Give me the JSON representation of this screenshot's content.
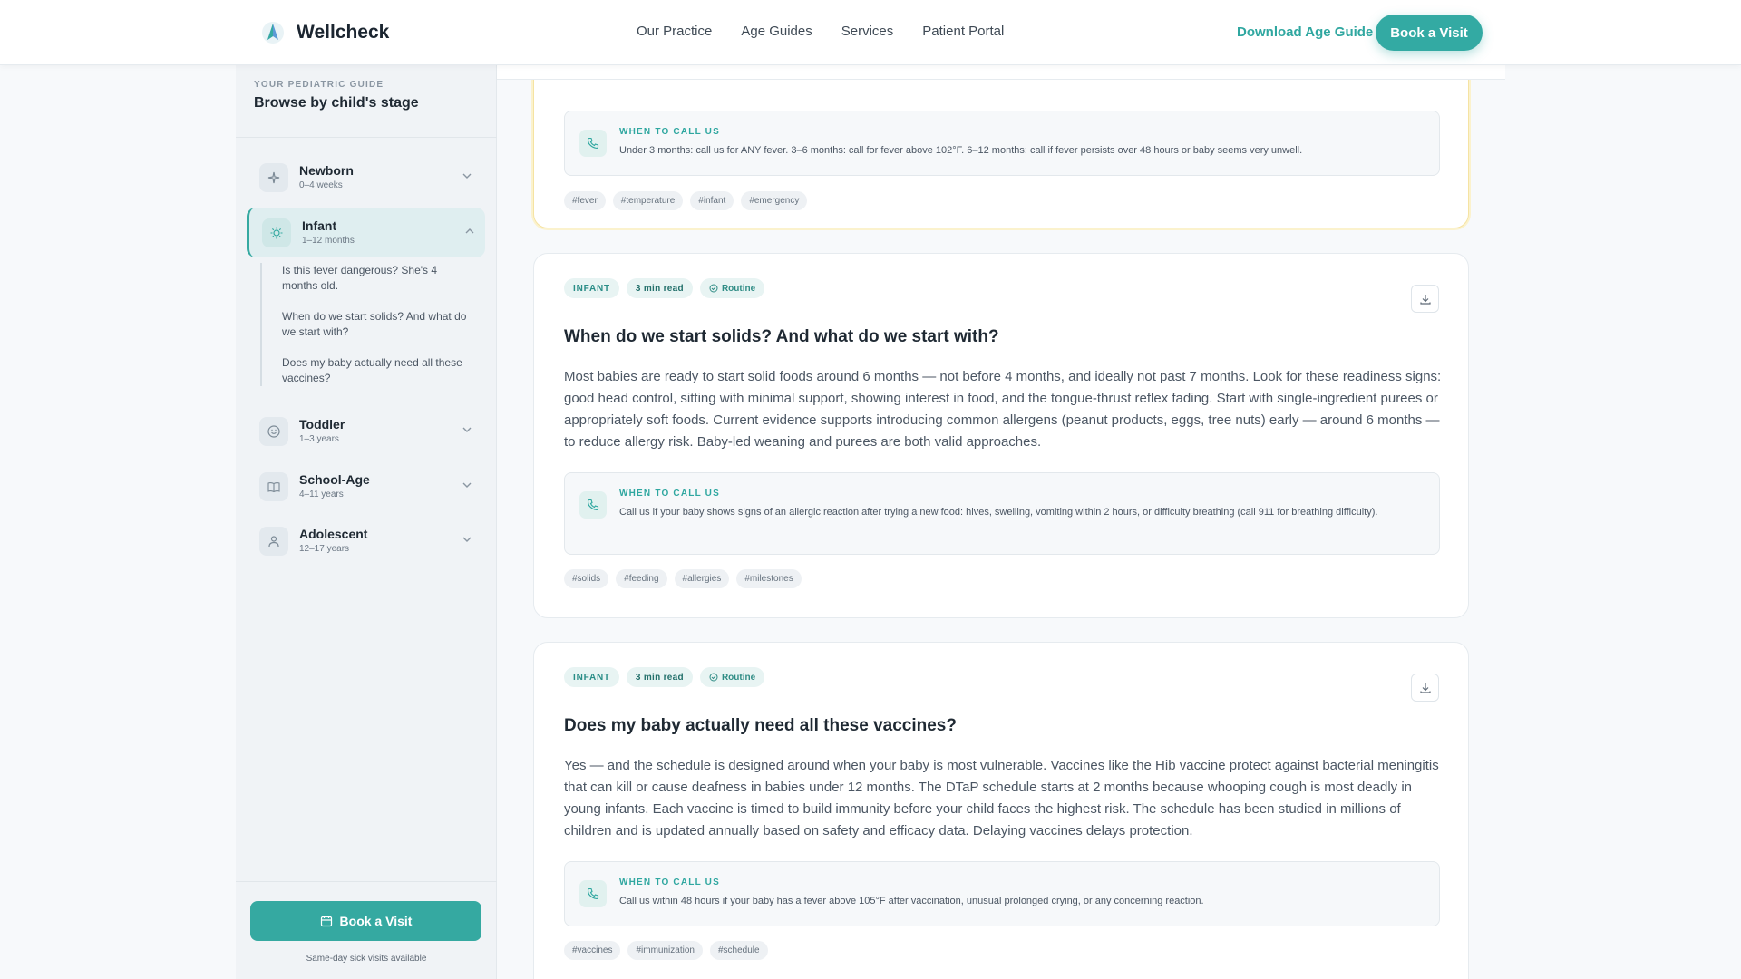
{
  "header": {
    "brand": "Wellcheck",
    "nav": [
      "Our Practice",
      "Age Guides",
      "Services",
      "Patient Portal"
    ],
    "download_label": "Download Age Guide",
    "book_label": "Book a Visit"
  },
  "sidebar": {
    "eyebrow": "YOUR PEDIATRIC GUIDE",
    "title": "Browse by child's stage",
    "stages": [
      {
        "name": "Newborn",
        "range": "0–4 weeks",
        "icon": "sparkle-icon"
      },
      {
        "name": "Infant",
        "range": "1–12 months",
        "icon": "sun-icon"
      },
      {
        "name": "Toddler",
        "range": "1–3 years",
        "icon": "smile-icon"
      },
      {
        "name": "School-Age",
        "range": "4–11 years",
        "icon": "book-icon"
      },
      {
        "name": "Adolescent",
        "range": "12–17 years",
        "icon": "person-icon"
      }
    ],
    "active_stage": "Infant",
    "infant_questions": [
      "Is this fever dangerous? She's 4 months old.",
      "When do we start solids? And what do we start with?",
      "Does my baby actually need all these vaccines?"
    ],
    "book_label": "Book a Visit",
    "note": "Same-day sick visits available"
  },
  "cards": [
    {
      "call_label": "WHEN TO CALL US",
      "call_text": "Under 3 months: call us for ANY fever. 3–6 months: call for fever above 102°F. 6–12 months: call if fever persists over 48 hours or baby seems very unwell.",
      "hashtags": [
        "#fever",
        "#temperature",
        "#infant",
        "#emergency"
      ]
    },
    {
      "stage": "INFANT",
      "read": "3 min read",
      "status": "Routine",
      "title": "When do we start solids? And what do we start with?",
      "body": "Most babies are ready to start solid foods around 6 months — not before 4 months, and ideally not past 7 months. Look for these readiness signs: good head control, sitting with minimal support, showing interest in food, and the tongue-thrust reflex fading. Start with single-ingredient purees or appropriately soft foods. Current evidence supports introducing common allergens (peanut products, eggs, tree nuts) early — around 6 months — to reduce allergy risk. Baby-led weaning and purees are both valid approaches.",
      "call_label": "WHEN TO CALL US",
      "call_text": "Call us if your baby shows signs of an allergic reaction after trying a new food: hives, swelling, vomiting within 2 hours, or difficulty breathing (call 911 for breathing difficulty).",
      "hashtags": [
        "#solids",
        "#feeding",
        "#allergies",
        "#milestones"
      ]
    },
    {
      "stage": "INFANT",
      "read": "3 min read",
      "status": "Routine",
      "title": "Does my baby actually need all these vaccines?",
      "body": "Yes — and the schedule is designed around when your baby is most vulnerable. Vaccines like the Hib vaccine protect against bacterial meningitis that can kill or cause deafness in babies under 12 months. The DTaP schedule starts at 2 months because whooping cough is most deadly in young infants. Each vaccine is timed to build immunity before your child faces the highest risk. The schedule has been studied in millions of children and is updated annually based on safety and efficacy data. Delaying vaccines delays protection.",
      "call_label": "WHEN TO CALL US",
      "call_text": "Call us within 48 hours if your baby has a fever above 105°F after vaccination, unusual prolonged crying, or any concerning reaction.",
      "hashtags": [
        "#vaccines",
        "#immunization",
        "#schedule"
      ]
    }
  ],
  "colors": {
    "accent": "#35a9a1",
    "highlight_border": "#f5e3a3"
  }
}
